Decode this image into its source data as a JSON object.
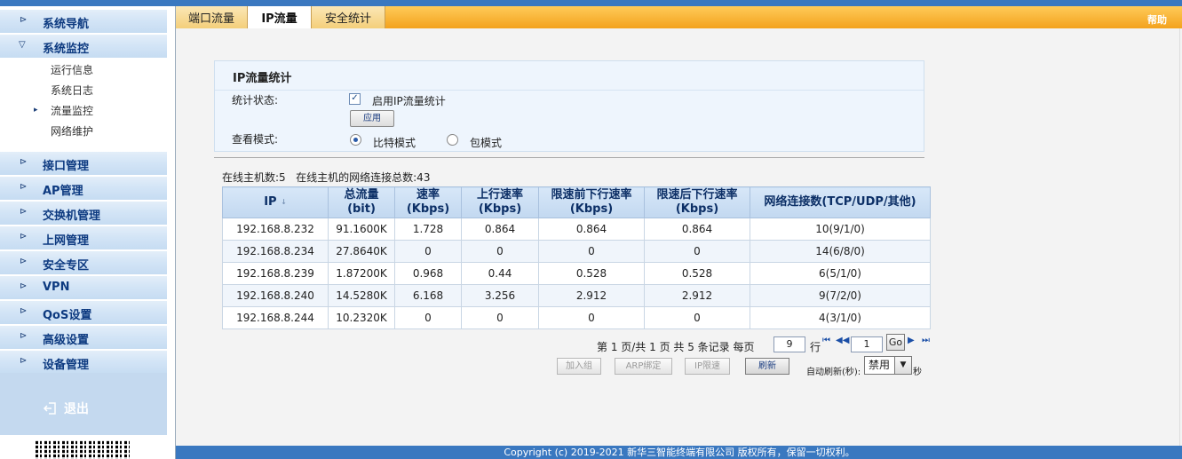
{
  "sidebar": {
    "items": [
      {
        "label": "系统导航"
      },
      {
        "label": "系统监控"
      },
      {
        "label": "接口管理"
      },
      {
        "label": "AP管理"
      },
      {
        "label": "交换机管理"
      },
      {
        "label": "上网管理"
      },
      {
        "label": "安全专区"
      },
      {
        "label": "VPN"
      },
      {
        "label": "QoS设置"
      },
      {
        "label": "高级设置"
      },
      {
        "label": "设备管理"
      }
    ],
    "subitems": [
      {
        "label": "运行信息"
      },
      {
        "label": "系统日志"
      },
      {
        "label": "流量监控"
      },
      {
        "label": "网络维护"
      }
    ],
    "logout_label": "退出"
  },
  "tabs": [
    {
      "label": "端口流量"
    },
    {
      "label": "IP流量"
    },
    {
      "label": "安全统计"
    }
  ],
  "help_label": "帮助",
  "panel": {
    "title": "IP流量统计",
    "status_label": "统计状态:",
    "enable_label": "启用IP流量统计",
    "enable_checked": true,
    "apply_label": "应用",
    "mode_label": "查看模式:",
    "mode_options": [
      {
        "label": "比特模式",
        "selected": true
      },
      {
        "label": "包模式",
        "selected": false
      }
    ]
  },
  "summary": {
    "online_label": "在线主机数:5",
    "connections_label": "在线主机的网络连接总数:43"
  },
  "table": {
    "headers": [
      "IP",
      "总流量\n(bit)",
      "速率\n(Kbps)",
      "上行速率\n(Kbps)",
      "限速前下行速率\n(Kbps)",
      "限速后下行速率\n(Kbps)",
      "网络连接数(TCP/UDP/其他)"
    ],
    "header_lines": [
      [
        "IP",
        ""
      ],
      [
        "总流量",
        "(bit)"
      ],
      [
        "速率",
        "(Kbps)"
      ],
      [
        "上行速率",
        "(Kbps)"
      ],
      [
        "限速前下行速率",
        "(Kbps)"
      ],
      [
        "限速后下行速率",
        "(Kbps)"
      ],
      [
        "网络连接数(TCP/UDP/其他)",
        ""
      ]
    ],
    "rows": [
      [
        "192.168.8.232",
        "91.1600K",
        "1.728",
        "0.864",
        "0.864",
        "0.864",
        "10(9/1/0)"
      ],
      [
        "192.168.8.234",
        "27.8640K",
        "0",
        "0",
        "0",
        "0",
        "14(6/8/0)"
      ],
      [
        "192.168.8.239",
        "1.87200K",
        "0.968",
        "0.44",
        "0.528",
        "0.528",
        "6(5/1/0)"
      ],
      [
        "192.168.8.240",
        "14.5280K",
        "6.168",
        "3.256",
        "2.912",
        "2.912",
        "9(7/2/0)"
      ],
      [
        "192.168.8.244",
        "10.2320K",
        "0",
        "0",
        "0",
        "0",
        "4(3/1/0)"
      ]
    ]
  },
  "pager": {
    "page_text": "第 1 页/共 1 页 共 5 条记录 每页",
    "per_page": "9",
    "row_unit": "行",
    "goto_page": "1",
    "go_label": "Go"
  },
  "actions": {
    "add_group": "加入组",
    "arp_bind": "ARP绑定",
    "ip_limit": "IP限速",
    "refresh": "刷新",
    "auto_refresh_label": "自动刷新(秒):",
    "auto_refresh_value": "禁用",
    "seconds_label": "秒"
  },
  "footer": "Copyright (c) 2019-2021 新华三智能终端有限公司 版权所有，保留一切权利。"
}
